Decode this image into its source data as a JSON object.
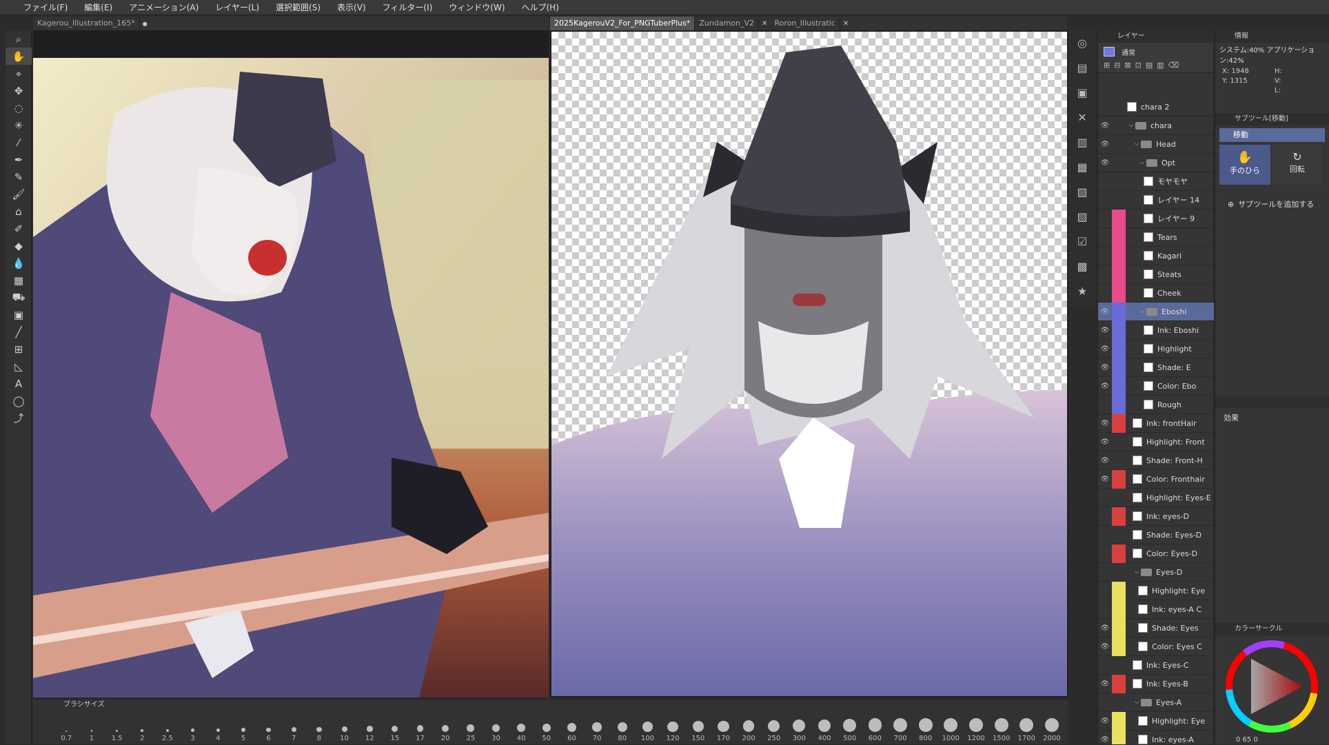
{
  "menu": [
    "ファイル(F)",
    "編集(E)",
    "アニメーション(A)",
    "レイヤー(L)",
    "選択範囲(S)",
    "表示(V)",
    "フィルター(I)",
    "ウィンドウ(W)",
    "ヘルプ(H)"
  ],
  "tabs_left": [
    {
      "label": "Kagerou_Illustration_165*"
    }
  ],
  "tabs_right": [
    {
      "label": "2025KagerouV2_For_PNGTuberPlus*"
    },
    {
      "label": "Zundamon_V2"
    },
    {
      "label": "Roron_Illustratic"
    }
  ],
  "brush_panel": {
    "title": "ブラシサイズ",
    "sizes": [
      "0.7",
      "1",
      "1.5",
      "2",
      "2.5",
      "3",
      "4",
      "5",
      "6",
      "7",
      "8",
      "10",
      "12",
      "15",
      "17",
      "20",
      "25",
      "30",
      "40",
      "50",
      "60",
      "70",
      "80",
      "100",
      "120",
      "150",
      "170",
      "200",
      "250",
      "300",
      "400",
      "500",
      "600",
      "700",
      "800",
      "1000",
      "1200",
      "1500",
      "1700",
      "2000"
    ]
  },
  "layer_panel": {
    "title": "レイヤー",
    "blend_mode": "通常",
    "layers": [
      {
        "name": "chara 2",
        "type": "layer",
        "indent": 0,
        "eye": false,
        "color": ""
      },
      {
        "name": "chara",
        "type": "folder",
        "indent": 0,
        "eye": true,
        "color": ""
      },
      {
        "name": "Head",
        "type": "folder",
        "indent": 1,
        "eye": true,
        "color": ""
      },
      {
        "name": "Opt",
        "type": "folder",
        "indent": 2,
        "eye": true,
        "color": ""
      },
      {
        "name": "モヤモヤ",
        "type": "layer",
        "indent": 3,
        "eye": false,
        "color": ""
      },
      {
        "name": "レイヤー 14",
        "type": "layer",
        "indent": 3,
        "eye": false,
        "color": ""
      },
      {
        "name": "レイヤー 9",
        "type": "layer",
        "indent": 3,
        "eye": false,
        "color": "#e84a8a"
      },
      {
        "name": "Tears",
        "type": "layer",
        "indent": 3,
        "eye": false,
        "color": "#e84a8a"
      },
      {
        "name": "Kagari",
        "type": "layer",
        "indent": 3,
        "eye": false,
        "color": "#e84a8a"
      },
      {
        "name": "Steats",
        "type": "layer",
        "indent": 3,
        "eye": false,
        "color": "#e84a8a"
      },
      {
        "name": "Cheek",
        "type": "layer",
        "indent": 3,
        "eye": false,
        "color": "#e84a8a"
      },
      {
        "name": "Eboshi",
        "type": "folder",
        "indent": 2,
        "eye": true,
        "color": "#6a6ad8",
        "selected": true
      },
      {
        "name": "Ink: Eboshi",
        "type": "layer",
        "indent": 3,
        "eye": true,
        "color": "#6a6ad8"
      },
      {
        "name": "Highlight",
        "type": "layer",
        "indent": 3,
        "eye": true,
        "color": "#6a6ad8"
      },
      {
        "name": "Shade: E",
        "type": "layer",
        "indent": 3,
        "eye": true,
        "color": "#6a6ad8"
      },
      {
        "name": "Color: Ebo",
        "type": "layer",
        "indent": 3,
        "eye": true,
        "color": "#6a6ad8"
      },
      {
        "name": "Rough",
        "type": "layer",
        "indent": 3,
        "eye": false,
        "color": "#6a6ad8"
      },
      {
        "name": "Ink: frontHair",
        "type": "layer",
        "indent": 1,
        "eye": true,
        "color": "#d84040"
      },
      {
        "name": "Highlight: Front",
        "type": "layer",
        "indent": 1,
        "eye": true,
        "color": ""
      },
      {
        "name": "Shade: Front-H",
        "type": "layer",
        "indent": 1,
        "eye": true,
        "color": ""
      },
      {
        "name": "Color: Fronthair",
        "type": "layer",
        "indent": 1,
        "eye": true,
        "color": "#d84040"
      },
      {
        "name": "Highlight: Eyes-E",
        "type": "layer",
        "indent": 1,
        "eye": false,
        "color": ""
      },
      {
        "name": "Ink: eyes-D",
        "type": "layer",
        "indent": 1,
        "eye": false,
        "color": "#d84040"
      },
      {
        "name": "Shade: Eyes-D",
        "type": "layer",
        "indent": 1,
        "eye": false,
        "color": ""
      },
      {
        "name": "Color: Eyes-D",
        "type": "layer",
        "indent": 1,
        "eye": false,
        "color": "#d84040"
      },
      {
        "name": "Eyes-D",
        "type": "folder",
        "indent": 1,
        "eye": false,
        "color": ""
      },
      {
        "name": "Highlight: Eye",
        "type": "layer",
        "indent": 2,
        "eye": false,
        "color": "#e8e060"
      },
      {
        "name": "Ink: eyes-A C",
        "type": "layer",
        "indent": 2,
        "eye": false,
        "color": "#e8e060"
      },
      {
        "name": "Shade: Eyes",
        "type": "layer",
        "indent": 2,
        "eye": true,
        "color": "#e8e060"
      },
      {
        "name": "Color: Eyes C",
        "type": "layer",
        "indent": 2,
        "eye": true,
        "color": "#e8e060"
      },
      {
        "name": "Ink: Eyes-C",
        "type": "layer",
        "indent": 1,
        "eye": false,
        "color": ""
      },
      {
        "name": "Ink: Eyes-B",
        "type": "layer",
        "indent": 1,
        "eye": true,
        "color": "#d84040"
      },
      {
        "name": "Eyes-A",
        "type": "folder",
        "indent": 1,
        "eye": false,
        "color": ""
      },
      {
        "name": "Highlight: Eye",
        "type": "layer",
        "indent": 2,
        "eye": true,
        "color": "#e8e060"
      },
      {
        "name": "Ink: eyes-A",
        "type": "layer",
        "indent": 2,
        "eye": true,
        "color": "#e8e060"
      }
    ]
  },
  "info_panel": {
    "title": "情報",
    "system_label": "システム:40% アプリケーション:42%",
    "x": "X: 1948",
    "y": "Y: 1315",
    "h": "H:",
    "v": "V:",
    "l": "L:"
  },
  "subtool_panel": {
    "title": "サブツール[移動]",
    "group": "移動",
    "tools": [
      {
        "label": "手のひら"
      },
      {
        "label": "回転"
      }
    ],
    "add_label": "サブツールを追加する"
  },
  "effect_panel": {
    "title": "効果"
  },
  "color_panel": {
    "title": "カラーサークル",
    "values": "0 65 0"
  },
  "colors": {
    "accent": "#5a6a9a",
    "bg": "#2b2b2b",
    "panel": "#353535"
  }
}
